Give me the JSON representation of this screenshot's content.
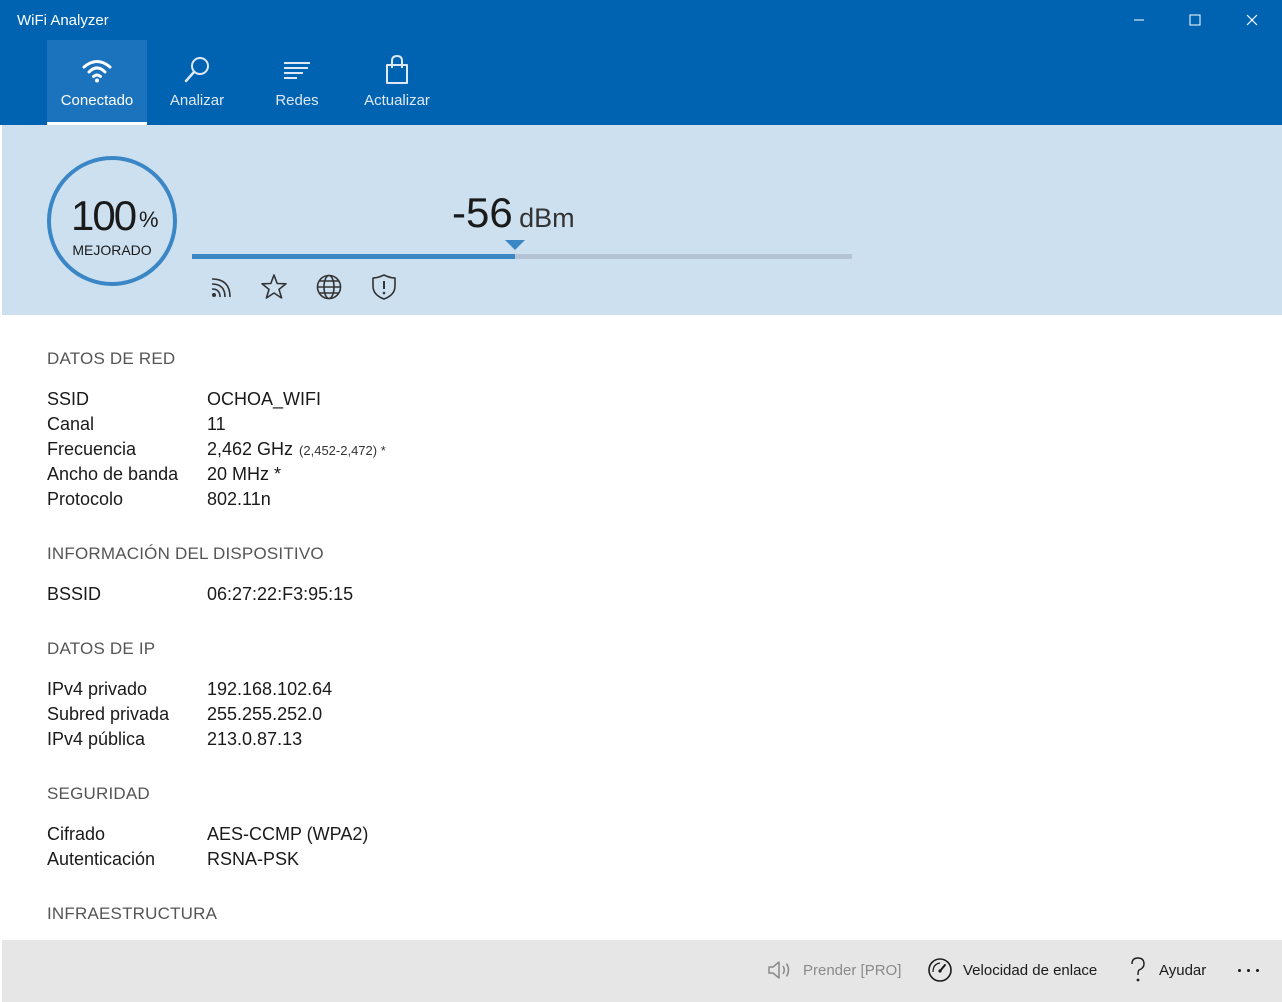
{
  "window": {
    "title": "WiFi Analyzer"
  },
  "nav": {
    "tabs": [
      {
        "label": "Conectado",
        "icon": "wifi-icon",
        "active": true
      },
      {
        "label": "Analizar",
        "icon": "magnifier-icon",
        "active": false
      },
      {
        "label": "Redes",
        "icon": "list-icon",
        "active": false
      },
      {
        "label": "Actualizar",
        "icon": "shopping-bag-icon",
        "active": false
      }
    ]
  },
  "signal": {
    "quality_value": "100",
    "quality_unit": "%",
    "quality_caption": "MEJORADO",
    "dbm_value": "-56",
    "dbm_unit": "dBm",
    "meter_fraction": 0.49,
    "status_icons": [
      "wifi-signal-icon",
      "star-icon",
      "globe-icon",
      "shield-icon"
    ]
  },
  "sections": {
    "network": {
      "title": "DATOS DE RED",
      "rows": [
        {
          "label": "SSID",
          "value": "OCHOA_WIFI"
        },
        {
          "label": "Canal",
          "value": "11"
        },
        {
          "label": "Frecuencia",
          "value": "2,462 GHz",
          "note": "(2,452-2,472) *"
        },
        {
          "label": "Ancho de banda",
          "value": "20 MHz *"
        },
        {
          "label": "Protocolo",
          "value": "802.11n"
        }
      ]
    },
    "device": {
      "title": "INFORMACIÓN DEL DISPOSITIVO",
      "rows": [
        {
          "label": "BSSID",
          "value": "06:27:22:F3:95:15"
        }
      ]
    },
    "ip": {
      "title": "DATOS DE IP",
      "rows": [
        {
          "label": "IPv4 privado",
          "value": "192.168.102.64"
        },
        {
          "label": "Subred privada",
          "value": "255.255.252.0"
        },
        {
          "label": "IPv4 pública",
          "value": "213.0.87.13"
        }
      ]
    },
    "security": {
      "title": "SEGURIDAD",
      "rows": [
        {
          "label": "Cifrado",
          "value": "AES-CCMP (WPA2)"
        },
        {
          "label": "Autenticación",
          "value": "RSNA-PSK"
        }
      ]
    },
    "infrastructure": {
      "title": "INFRAESTRUCTURA"
    }
  },
  "footer": {
    "speak_label": "Prender [PRO]",
    "link_speed_label": "Velocidad de enlace",
    "help_label": "Ayudar"
  },
  "colors": {
    "accent": "#0063b1",
    "panel": "#cde0f0",
    "meter": "#3b86c5"
  }
}
